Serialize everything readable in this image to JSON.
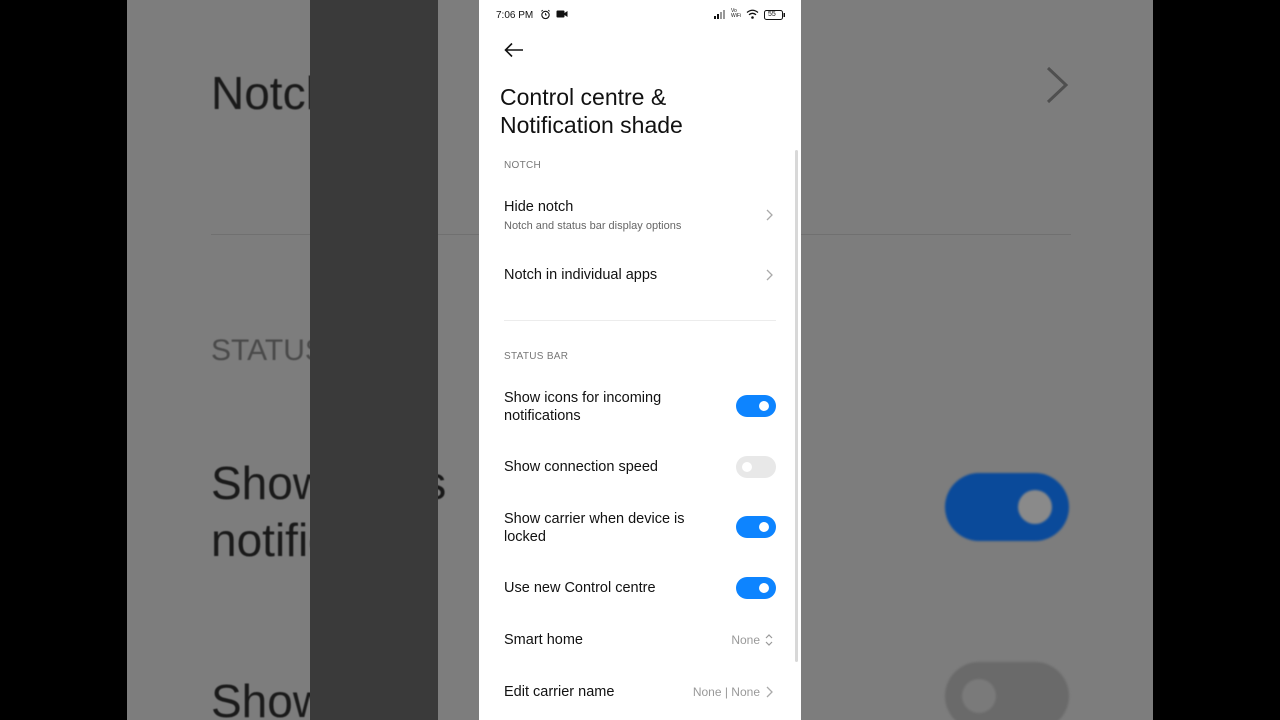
{
  "status_bar": {
    "time": "7:06 PM",
    "battery": "55",
    "volte": "Vo WiFi"
  },
  "page": {
    "title_line1": "Control centre &",
    "title_line2": "Notification shade"
  },
  "sections": {
    "notch": "NOTCH",
    "status_bar": "STATUS BAR"
  },
  "notch_items": {
    "hide_notch": {
      "label": "Hide notch",
      "sub": "Notch and status bar display options"
    },
    "notch_apps": {
      "label": "Notch in individual apps"
    }
  },
  "status_items": {
    "show_icons": {
      "label_line1": "Show icons for incoming",
      "label_line2": "notifications",
      "enabled": true
    },
    "connection_speed": {
      "label": "Show connection speed",
      "enabled": false
    },
    "carrier_locked": {
      "label_line1": "Show carrier when device is",
      "label_line2": "locked",
      "enabled": true
    },
    "new_control_centre": {
      "label": "Use new Control centre",
      "enabled": true
    },
    "smart_home": {
      "label": "Smart home",
      "value": "None"
    },
    "edit_carrier": {
      "label": "Edit carrier name",
      "value": "None | None"
    }
  },
  "background": {
    "notch_text": "Notch in in",
    "status_section": "STATUS BAR",
    "show_icons_1": "Show icons",
    "show_icons_2": "notificatio",
    "show_conn": "Show conn"
  },
  "colors": {
    "accent": "#0d84ff",
    "toggle_off": "#e8e8e8"
  }
}
